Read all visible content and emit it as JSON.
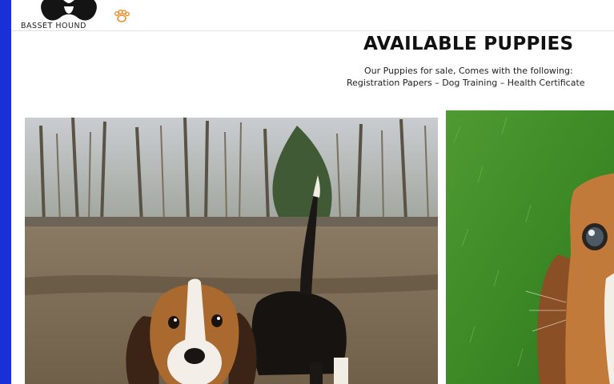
{
  "logo": {
    "text": "BASSET HOUND",
    "icon": "dog-silhouette-icon",
    "paw": "paw-icon"
  },
  "page": {
    "title": "AVAILABLE PUPPIES",
    "subtitle_line1": "Our Puppies for sale, Comes with the following:",
    "subtitle_line2": "Registration Papers – Dog Training – Health Certificate"
  },
  "colors": {
    "frame": "#1a2fd6",
    "background": "#ffffff",
    "text": "#111111",
    "paw": "#f08a2a"
  },
  "puppies": [
    {
      "image": "basset-puppy-in-field-photo"
    },
    {
      "image": "basset-puppy-on-grass-photo"
    }
  ]
}
